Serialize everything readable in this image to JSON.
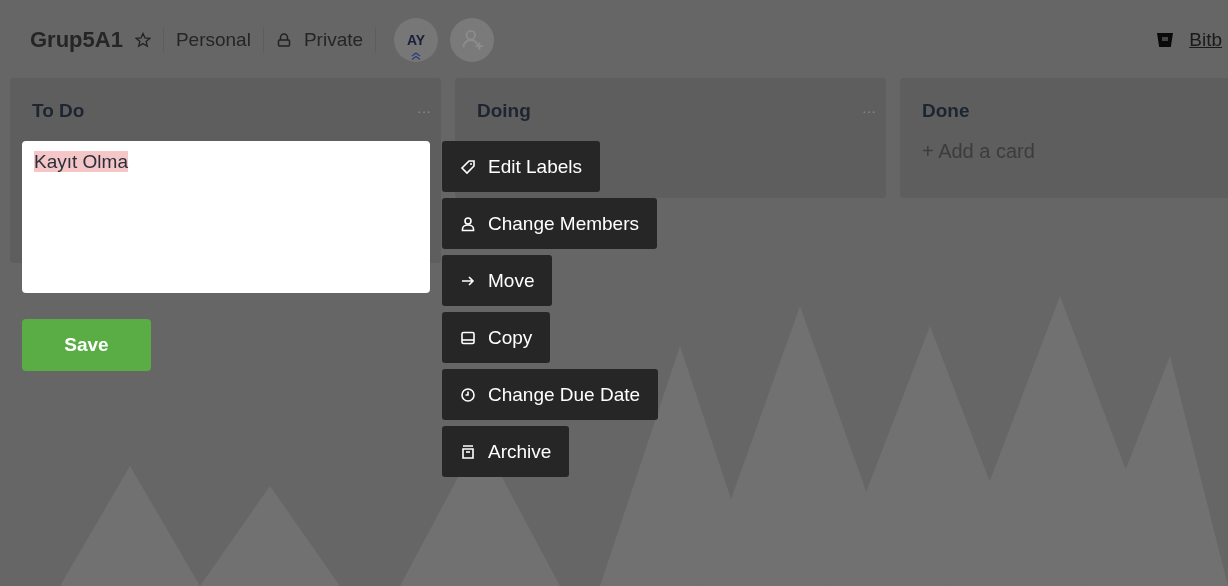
{
  "board": {
    "title": "Grup5A1",
    "starred": false,
    "team": "Personal",
    "visibility": "Private",
    "member": {
      "initials": "AY",
      "admin": true
    },
    "power_up": {
      "label": "Bitb"
    }
  },
  "lists": [
    {
      "title": "To Do",
      "menu": "···"
    },
    {
      "title": "Doing",
      "menu": "···"
    },
    {
      "title": "Done",
      "add_card": "+ Add a card"
    }
  ],
  "card_editor": {
    "value": "Kayıt Olma",
    "save": "Save"
  },
  "quick_menu": [
    {
      "kind": "labels",
      "label": "Edit Labels"
    },
    {
      "kind": "members",
      "label": "Change Members"
    },
    {
      "kind": "move",
      "label": "Move"
    },
    {
      "kind": "copy",
      "label": "Copy"
    },
    {
      "kind": "due",
      "label": "Change Due Date"
    },
    {
      "kind": "archive",
      "label": "Archive"
    }
  ]
}
